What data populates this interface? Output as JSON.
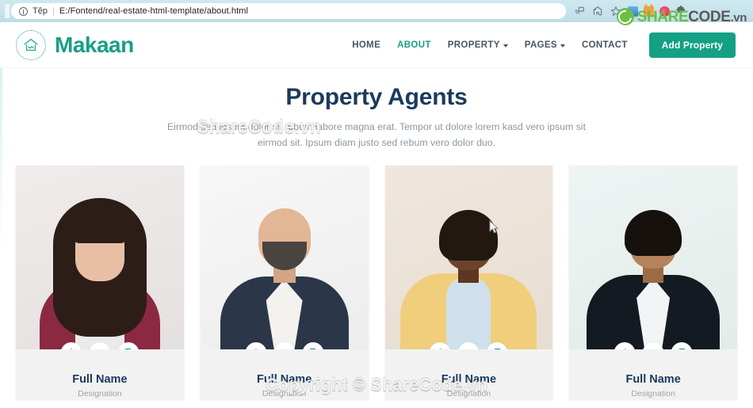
{
  "browser": {
    "scheme_label": "Tệp",
    "separator": "|",
    "url": "E:/Fontend/real-estate-html-template/about.html",
    "icons": [
      {
        "name": "media-cast-icon"
      },
      {
        "name": "share-icon"
      },
      {
        "name": "bookmark-star-icon"
      }
    ],
    "extensions": [
      {
        "name": "extension-blue-icon"
      },
      {
        "name": "extension-cat-icon"
      },
      {
        "name": "extension-red-icon"
      },
      {
        "name": "extensions-puzzle-icon"
      }
    ]
  },
  "watermark": {
    "logo_a": "SHARE",
    "logo_b": "CODE",
    "logo_c": ".vn",
    "overlay_top": "ShareCode.vn",
    "overlay_bottom": "Copyright © ShareCode.vn"
  },
  "header": {
    "brand": "Makaan",
    "brand_icon": "house-handshake-icon",
    "nav": [
      {
        "label": "HOME",
        "active": false,
        "has_caret": false
      },
      {
        "label": "ABOUT",
        "active": true,
        "has_caret": false
      },
      {
        "label": "PROPERTY",
        "active": false,
        "has_caret": true
      },
      {
        "label": "PAGES",
        "active": false,
        "has_caret": true
      },
      {
        "label": "CONTACT",
        "active": false,
        "has_caret": false
      }
    ],
    "cta_label": "Add Property",
    "accent_color": "#14a085"
  },
  "main": {
    "title": "Property Agents",
    "subtitle": "Eirmod sed ipsum dolor sit rebum labore magna erat. Tempor ut dolore lorem kasd vero ipsum sit eirmod sit. Ipsum diam justo sed rebum vero dolor duo.",
    "title_color": "#1b3a5c",
    "agents": [
      {
        "name": "Full Name",
        "designation": "Designation",
        "photo_alt": "woman-dark-wavy-hair-maroon-cardigan",
        "socials": [
          "facebook-icon",
          "twitter-icon",
          "instagram-icon"
        ]
      },
      {
        "name": "Full Name",
        "designation": "Designation",
        "photo_alt": "bald-bearded-man-navy-blazer",
        "socials": [
          "facebook-icon",
          "twitter-icon",
          "instagram-icon"
        ]
      },
      {
        "name": "Full Name",
        "designation": "Designation",
        "photo_alt": "woman-short-hair-yellow-blazer",
        "socials": [
          "facebook-icon",
          "twitter-icon",
          "instagram-icon"
        ]
      },
      {
        "name": "Full Name",
        "designation": "Designation",
        "photo_alt": "young-man-black-suit-white-shirt",
        "socials": [
          "facebook-icon",
          "twitter-icon",
          "instagram-icon"
        ]
      }
    ]
  }
}
